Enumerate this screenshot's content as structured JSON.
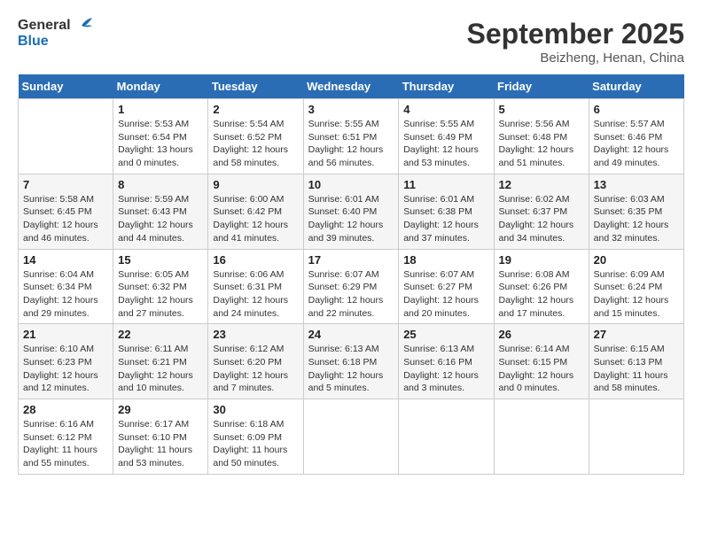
{
  "header": {
    "logo_line1": "General",
    "logo_line2": "Blue",
    "month": "September 2025",
    "location": "Beizheng, Henan, China"
  },
  "days_of_week": [
    "Sunday",
    "Monday",
    "Tuesday",
    "Wednesday",
    "Thursday",
    "Friday",
    "Saturday"
  ],
  "weeks": [
    [
      {
        "day": "",
        "info": ""
      },
      {
        "day": "1",
        "info": "Sunrise: 5:53 AM\nSunset: 6:54 PM\nDaylight: 13 hours\nand 0 minutes."
      },
      {
        "day": "2",
        "info": "Sunrise: 5:54 AM\nSunset: 6:52 PM\nDaylight: 12 hours\nand 58 minutes."
      },
      {
        "day": "3",
        "info": "Sunrise: 5:55 AM\nSunset: 6:51 PM\nDaylight: 12 hours\nand 56 minutes."
      },
      {
        "day": "4",
        "info": "Sunrise: 5:55 AM\nSunset: 6:49 PM\nDaylight: 12 hours\nand 53 minutes."
      },
      {
        "day": "5",
        "info": "Sunrise: 5:56 AM\nSunset: 6:48 PM\nDaylight: 12 hours\nand 51 minutes."
      },
      {
        "day": "6",
        "info": "Sunrise: 5:57 AM\nSunset: 6:46 PM\nDaylight: 12 hours\nand 49 minutes."
      }
    ],
    [
      {
        "day": "7",
        "info": "Sunrise: 5:58 AM\nSunset: 6:45 PM\nDaylight: 12 hours\nand 46 minutes."
      },
      {
        "day": "8",
        "info": "Sunrise: 5:59 AM\nSunset: 6:43 PM\nDaylight: 12 hours\nand 44 minutes."
      },
      {
        "day": "9",
        "info": "Sunrise: 6:00 AM\nSunset: 6:42 PM\nDaylight: 12 hours\nand 41 minutes."
      },
      {
        "day": "10",
        "info": "Sunrise: 6:01 AM\nSunset: 6:40 PM\nDaylight: 12 hours\nand 39 minutes."
      },
      {
        "day": "11",
        "info": "Sunrise: 6:01 AM\nSunset: 6:38 PM\nDaylight: 12 hours\nand 37 minutes."
      },
      {
        "day": "12",
        "info": "Sunrise: 6:02 AM\nSunset: 6:37 PM\nDaylight: 12 hours\nand 34 minutes."
      },
      {
        "day": "13",
        "info": "Sunrise: 6:03 AM\nSunset: 6:35 PM\nDaylight: 12 hours\nand 32 minutes."
      }
    ],
    [
      {
        "day": "14",
        "info": "Sunrise: 6:04 AM\nSunset: 6:34 PM\nDaylight: 12 hours\nand 29 minutes."
      },
      {
        "day": "15",
        "info": "Sunrise: 6:05 AM\nSunset: 6:32 PM\nDaylight: 12 hours\nand 27 minutes."
      },
      {
        "day": "16",
        "info": "Sunrise: 6:06 AM\nSunset: 6:31 PM\nDaylight: 12 hours\nand 24 minutes."
      },
      {
        "day": "17",
        "info": "Sunrise: 6:07 AM\nSunset: 6:29 PM\nDaylight: 12 hours\nand 22 minutes."
      },
      {
        "day": "18",
        "info": "Sunrise: 6:07 AM\nSunset: 6:27 PM\nDaylight: 12 hours\nand 20 minutes."
      },
      {
        "day": "19",
        "info": "Sunrise: 6:08 AM\nSunset: 6:26 PM\nDaylight: 12 hours\nand 17 minutes."
      },
      {
        "day": "20",
        "info": "Sunrise: 6:09 AM\nSunset: 6:24 PM\nDaylight: 12 hours\nand 15 minutes."
      }
    ],
    [
      {
        "day": "21",
        "info": "Sunrise: 6:10 AM\nSunset: 6:23 PM\nDaylight: 12 hours\nand 12 minutes."
      },
      {
        "day": "22",
        "info": "Sunrise: 6:11 AM\nSunset: 6:21 PM\nDaylight: 12 hours\nand 10 minutes."
      },
      {
        "day": "23",
        "info": "Sunrise: 6:12 AM\nSunset: 6:20 PM\nDaylight: 12 hours\nand 7 minutes."
      },
      {
        "day": "24",
        "info": "Sunrise: 6:13 AM\nSunset: 6:18 PM\nDaylight: 12 hours\nand 5 minutes."
      },
      {
        "day": "25",
        "info": "Sunrise: 6:13 AM\nSunset: 6:16 PM\nDaylight: 12 hours\nand 3 minutes."
      },
      {
        "day": "26",
        "info": "Sunrise: 6:14 AM\nSunset: 6:15 PM\nDaylight: 12 hours\nand 0 minutes."
      },
      {
        "day": "27",
        "info": "Sunrise: 6:15 AM\nSunset: 6:13 PM\nDaylight: 11 hours\nand 58 minutes."
      }
    ],
    [
      {
        "day": "28",
        "info": "Sunrise: 6:16 AM\nSunset: 6:12 PM\nDaylight: 11 hours\nand 55 minutes."
      },
      {
        "day": "29",
        "info": "Sunrise: 6:17 AM\nSunset: 6:10 PM\nDaylight: 11 hours\nand 53 minutes."
      },
      {
        "day": "30",
        "info": "Sunrise: 6:18 AM\nSunset: 6:09 PM\nDaylight: 11 hours\nand 50 minutes."
      },
      {
        "day": "",
        "info": ""
      },
      {
        "day": "",
        "info": ""
      },
      {
        "day": "",
        "info": ""
      },
      {
        "day": "",
        "info": ""
      }
    ]
  ]
}
